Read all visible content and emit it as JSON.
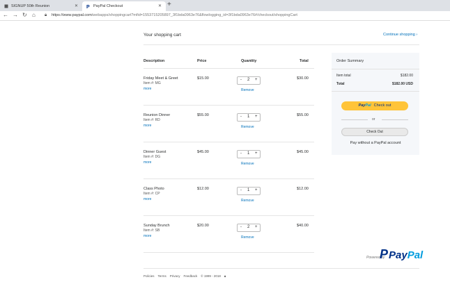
{
  "browser": {
    "tabs": [
      {
        "title": "SIGNUP 50th Reunion"
      },
      {
        "title": "PayPal Checkout"
      }
    ],
    "url_domain": "https://www.paypal.com",
    "url_rest": "/webapps/shoppingcart?mfid=1553715205897_3f1bda0963e76&flowlogging_id=3f1bda0963e76#/checkout/shoppingCart"
  },
  "cart": {
    "title": "Your shopping cart",
    "continue": "Continue shopping ›",
    "headers": {
      "description": "Description",
      "price": "Price",
      "quantity": "Quantity",
      "total": "Total"
    },
    "items": [
      {
        "name": "Friday Meet & Greet",
        "item": "Item #: MG",
        "more": "more",
        "price": "$15.00",
        "qty": "2",
        "remove": "Remove",
        "total": "$30.00"
      },
      {
        "name": "Reunion Dinner",
        "item": "Item #: RD",
        "more": "more",
        "price": "$55.00",
        "qty": "1",
        "remove": "Remove",
        "total": "$55.00"
      },
      {
        "name": "Dinner Guest",
        "item": "Item #: DG",
        "more": "more",
        "price": "$45.00",
        "qty": "1",
        "remove": "Remove",
        "total": "$45.00"
      },
      {
        "name": "Class Photo",
        "item": "Item #: CP",
        "more": "more",
        "price": "$12.00",
        "qty": "1",
        "remove": "Remove",
        "total": "$12.00"
      },
      {
        "name": "Sunday Brunch",
        "item": "Item #: SB",
        "more": "more",
        "price": "$20.00",
        "qty": "2",
        "remove": "Remove",
        "total": "$40.00"
      }
    ]
  },
  "summary": {
    "title": "Order Summary",
    "item_total_label": "Item total",
    "item_total_value": "$182.00",
    "total_label": "Total",
    "total_value": "$182.00 USD",
    "paypal_btn_pay": "Pay",
    "paypal_btn_pal": "Pal",
    "paypal_btn_text": "Check out",
    "or": "or",
    "checkout_btn": "Check Out",
    "pay_without": "Pay without a PayPal account"
  },
  "branding": {
    "powered_by": "Powered by",
    "logo_pay": "Pay",
    "logo_pal": "Pal"
  },
  "footer": {
    "links": [
      "Policies",
      "Terms",
      "Privacy",
      "Feedback",
      "© 1999 - 2018"
    ]
  },
  "colors": {
    "accent": "#0070ba",
    "paypal_yellow": "#ffc439",
    "paypal_dark": "#003087",
    "paypal_light": "#009cde"
  }
}
